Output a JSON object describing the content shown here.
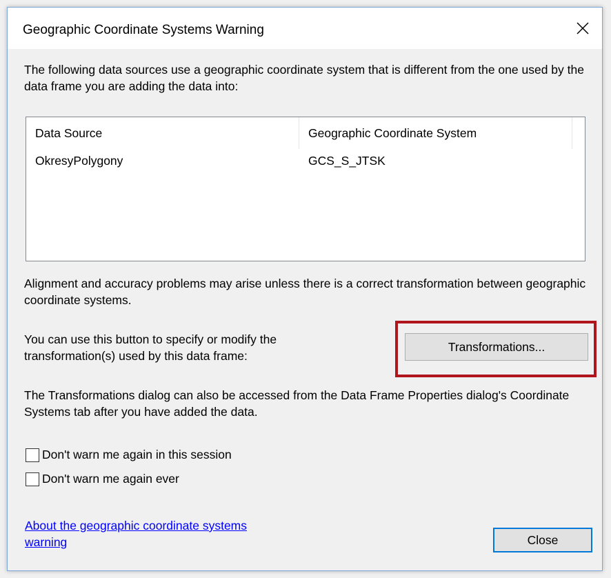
{
  "dialog": {
    "title": "Geographic Coordinate Systems Warning",
    "intro_text": "The following data sources use a geographic coordinate system that is different from the one used by the data frame you are adding the data into:",
    "table": {
      "columns": [
        "Data Source",
        "Geographic Coordinate System"
      ],
      "rows": [
        [
          "OkresyPolygony",
          "GCS_S_JTSK"
        ]
      ]
    },
    "alignment_text": "Alignment and accuracy problems may arise unless there is a correct transformation between geographic coordinate systems.",
    "button_hint_text": "You can use this button to specify or modify the transformation(s) used by this data frame:",
    "transformations_button_label": "Transformations...",
    "dialog_note_text": "The Transformations dialog can also be accessed from the Data Frame Properties dialog's Coordinate Systems tab after you have added the data.",
    "checkboxes": [
      {
        "label": "Don't warn me again in this session",
        "checked": false
      },
      {
        "label": "Don't warn me again ever",
        "checked": false
      }
    ],
    "help_link_text": "About the geographic coordinate systems warning",
    "close_button_label": "Close"
  },
  "colors": {
    "highlight_border": "#b0141c",
    "link": "#0000ff",
    "default_button_border": "#0078d7"
  },
  "icons": {
    "close": "close-icon"
  }
}
